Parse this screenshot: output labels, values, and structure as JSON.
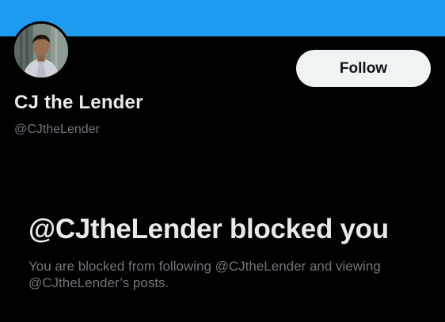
{
  "colors": {
    "banner": "#1d9bf0",
    "background": "#000000",
    "primary_text": "#e7e9ea",
    "secondary_text": "#71767b",
    "follow_button_bg": "#eff3f4",
    "follow_button_text": "#0f1419"
  },
  "profile": {
    "display_name": "CJ the Lender",
    "handle": "@CJtheLender",
    "avatar_icon": "profile-photo"
  },
  "actions": {
    "follow_label": "Follow"
  },
  "blocked": {
    "heading": "@CJtheLender blocked you",
    "message": "You are blocked from following @CJtheLender and viewing @CJtheLender’s posts."
  }
}
